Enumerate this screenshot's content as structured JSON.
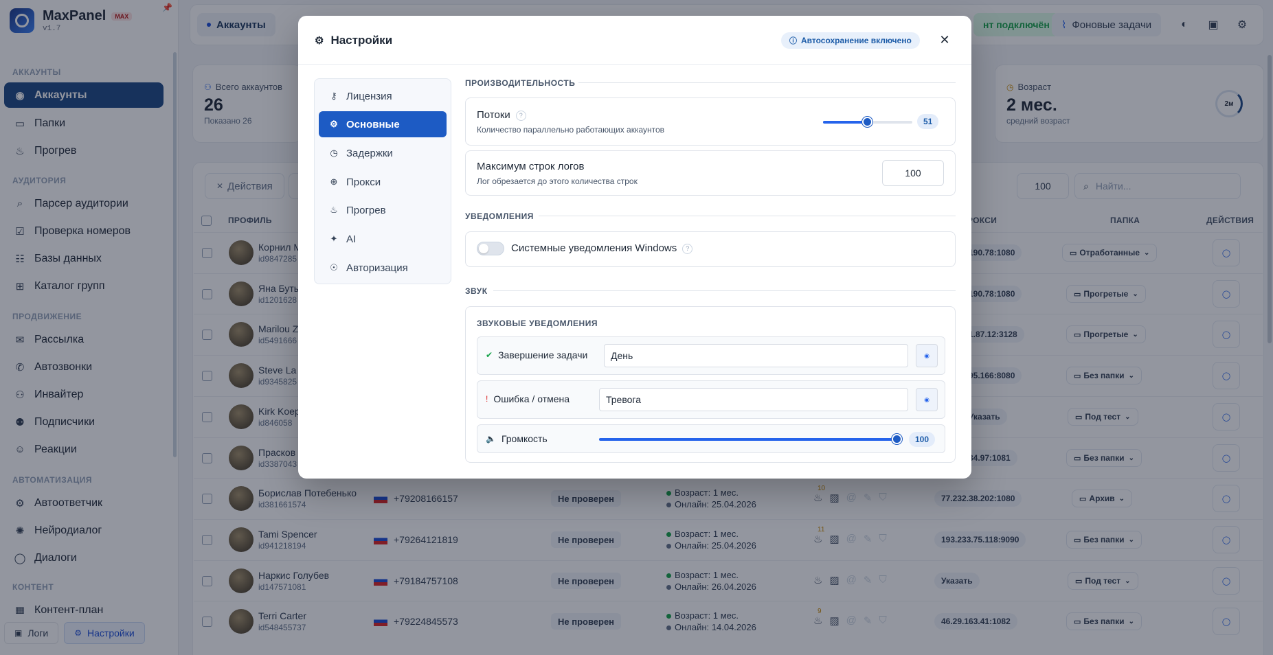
{
  "app": {
    "name": "MaxPanel",
    "badge": "MAX",
    "version": "v1.7"
  },
  "sidebar": {
    "sections": [
      "АККАУНТЫ",
      "АУДИТОРИЯ",
      "ПРОДВИЖЕНИЕ",
      "АВТОМАТИЗАЦИЯ",
      "КОНТЕНТ"
    ],
    "items": [
      "Аккаунты",
      "Папки",
      "Прогрев",
      "Парсер аудитории",
      "Проверка номеров",
      "Базы данных",
      "Каталог групп",
      "Рассылка",
      "Автозвонки",
      "Инвайтер",
      "Подписчики",
      "Реакции",
      "Автоответчик",
      "Нейродиалог",
      "Диалоги",
      "Контент-план"
    ],
    "footer": {
      "logs": "Логи",
      "settings": "Настройки"
    }
  },
  "topbar": {
    "crumb": "Аккаунты",
    "client_status": "нт подключён",
    "background_tasks": "Фоновые задачи"
  },
  "stats": {
    "total": {
      "label": "Всего аккаунтов",
      "value": "26",
      "sub": "Показано 26"
    },
    "age": {
      "label": "Возраст",
      "value": "2 мес.",
      "sub": "средний возраст",
      "ring": "2м"
    }
  },
  "toolbar": {
    "actions": "Действия",
    "page_size": "100",
    "search_placeholder": "Найти..."
  },
  "table": {
    "headers": {
      "profile": "ПРОФИЛЬ",
      "proxy": "РОКСИ",
      "folder": "ПАПКА",
      "actions": "ДЕЙСТВИЯ"
    },
    "rows": [
      {
        "name": "Корнил М",
        "id": "id9847285",
        "proxy": "190.78:1080",
        "folder": "Отработанные"
      },
      {
        "name": "Яна Буты",
        "id": "id1201628",
        "proxy": "190.78:1080",
        "folder": "Прогретые"
      },
      {
        "name": "Marilou Z",
        "id": "id5491666",
        "proxy": "1.87.12:3128",
        "folder": "Прогретые"
      },
      {
        "name": "Steve La",
        "id": "id9345825",
        "proxy": "95.166:8080",
        "folder": "Без папки"
      },
      {
        "name": "Kirk Koep",
        "id": "id846058",
        "proxy": "Указать",
        "folder": "Под тест"
      },
      {
        "name": "Прасков",
        "id": "id3387043",
        "proxy": "34.97:1081",
        "folder": "Без папки"
      },
      {
        "name": "Борислав Потебенько",
        "id": "id381661574",
        "phone": "+79208166157",
        "status": "Не проверен",
        "age": "Возраст: 1 мес.",
        "online": "Онлайн: 25.04.2026",
        "count": "10",
        "proxy": "77.232.38.202:1080",
        "folder": "Архив"
      },
      {
        "name": "Tami Spencer",
        "id": "id941218194",
        "phone": "+79264121819",
        "status": "Не проверен",
        "age": "Возраст: 1 мес.",
        "online": "Онлайн: 25.04.2026",
        "count": "11",
        "proxy": "193.233.75.118:9090",
        "folder": "Без папки"
      },
      {
        "name": "Наркис Голубев",
        "id": "id147571081",
        "phone": "+79184757108",
        "status": "Не проверен",
        "age": "Возраст: 1 мес.",
        "online": "Онлайн: 26.04.2026",
        "count": "",
        "proxy": "Указать",
        "folder": "Под тест"
      },
      {
        "name": "Terri Carter",
        "id": "id548455737",
        "phone": "+79224845573",
        "status": "Не проверен",
        "age": "Возраст: 1 мес.",
        "online": "Онлайн: 14.04.2026",
        "count": "9",
        "proxy": "46.29.163.41:1082",
        "folder": "Без папки"
      }
    ]
  },
  "modal": {
    "title": "Настройки",
    "autosave": "Автосохранение включено",
    "tabs": [
      "Лицензия",
      "Основные",
      "Задержки",
      "Прокси",
      "Прогрев",
      "AI",
      "Авторизация"
    ],
    "active_tab": "Основные",
    "performance": {
      "heading": "ПРОИЗВОДИТЕЛЬНОСТЬ",
      "threads": {
        "title": "Потоки",
        "sub": "Количество параллельно работающих аккаунтов",
        "value": "51",
        "level": 0.5
      },
      "logs": {
        "title": "Максимум строк логов",
        "sub": "Лог обрезается до этого количества строк",
        "value": "100"
      }
    },
    "notifications": {
      "heading": "УВЕДОМЛЕНИЯ",
      "windows": {
        "title": "Системные уведомления Windows",
        "enabled": false
      }
    },
    "sound": {
      "heading": "ЗВУК",
      "card_title": "ЗВУКОВЫЕ УВЕДОМЛЕНИЯ",
      "task_done": {
        "label": "Завершение задачи",
        "value": "День"
      },
      "error": {
        "label": "Ошибка / отмена",
        "value": "Тревога"
      },
      "volume": {
        "label": "Громкость",
        "value": "100",
        "level": 1.0
      }
    }
  },
  "colors": {
    "accent": "#1d5bc4",
    "sidebar_active": "#1e4a86",
    "success": "#16a34a",
    "error": "#dc2626"
  }
}
